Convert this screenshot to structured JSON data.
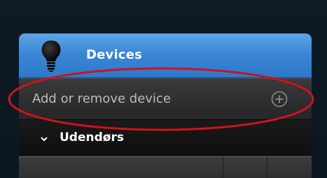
{
  "panel": {
    "header": {
      "title": "Devices",
      "icon": "lightbulb-icon",
      "accent_color": "#3b86d6"
    },
    "add_row": {
      "label": "Add or remove device",
      "icon": "plus-circle-icon"
    },
    "group": {
      "label": "Udendørs",
      "icon": "chevron-down-icon",
      "expanded": true
    }
  },
  "annotation": {
    "type": "highlight-oval",
    "color": "#d0121b"
  }
}
